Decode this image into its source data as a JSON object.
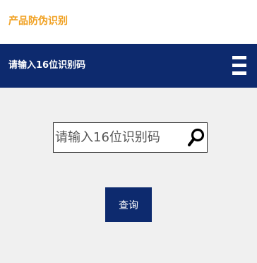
{
  "header": {
    "title": "产品防伪识别",
    "title_color": "#f0a020"
  },
  "nav": {
    "title": "请输入16位识别码",
    "background_color": "#0d2a6e",
    "menu_icon": "hamburger-menu-icon"
  },
  "search": {
    "value": "",
    "placeholder": "请输入16位识别码",
    "icon": "search-icon"
  },
  "query_button": {
    "label": "查询"
  }
}
